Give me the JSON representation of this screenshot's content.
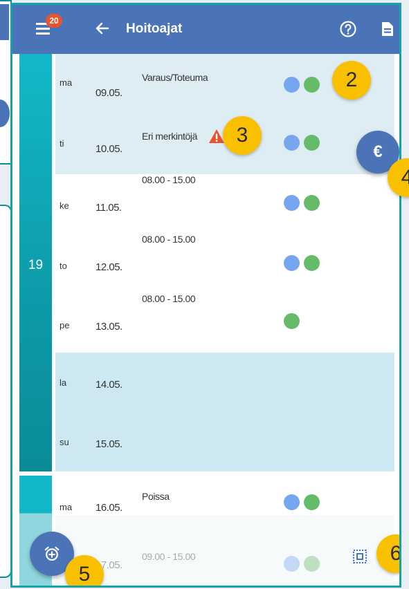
{
  "appbar": {
    "title": "Hoitoajat",
    "badge_count": "20",
    "icons": [
      "menu-icon",
      "back-arrow-icon",
      "help-circle-icon",
      "document-icon"
    ]
  },
  "week": {
    "number": "19"
  },
  "rows": [
    {
      "day": "ma",
      "date": "09.05.",
      "note": "Varaus/Toteuma",
      "dots": [
        "blue",
        "green"
      ]
    },
    {
      "day": "ti",
      "date": "10.05.",
      "note": "Eri merkintöjä",
      "dots": [
        "blue",
        "green"
      ],
      "warning": true
    },
    {
      "day": "ke",
      "date": "11.05.",
      "note": "08.00 - 15.00",
      "dots": [
        "blue",
        "green"
      ]
    },
    {
      "day": "to",
      "date": "12.05.",
      "note": "08.00 - 15.00",
      "dots": [
        "blue",
        "green"
      ]
    },
    {
      "day": "pe",
      "date": "13.05.",
      "note": "08.00 - 15.00",
      "dots": [
        "green"
      ]
    },
    {
      "day": "la",
      "date": "14.05.",
      "note": "",
      "dots": []
    },
    {
      "day": "su",
      "date": "15.05.",
      "note": "",
      "dots": []
    },
    {
      "day": "ma",
      "date": "16.05.",
      "note": "Poissa",
      "dots": [
        "blue",
        "green"
      ]
    },
    {
      "day": "ti",
      "date": "17.05.",
      "note": "09.00 - 15.00",
      "dots": [
        "blue",
        "green"
      ]
    }
  ],
  "callouts": {
    "c2": "2",
    "c3": "3",
    "c4": "4",
    "c5": "5",
    "c6": "6"
  },
  "fab": {
    "euro_symbol": "€",
    "alarm_icon": "alarm-add-icon"
  },
  "colors": {
    "appbar": "#4b73b8",
    "week_bar": "#13b8c8",
    "row_highlight": "#deedf3",
    "weekend": "#cde8f0",
    "dot_blue": "#76a7ee",
    "dot_green": "#66bb6a",
    "callout": "#f9c000",
    "warning": "#e8542e"
  }
}
